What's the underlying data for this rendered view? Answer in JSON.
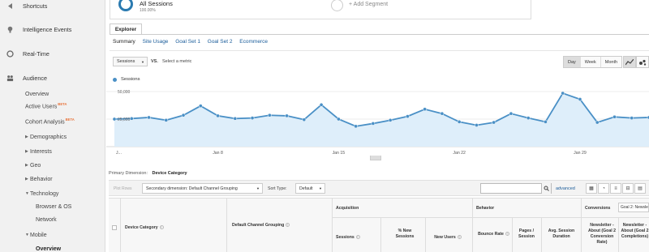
{
  "sidebar": {
    "items": [
      {
        "label": "Shortcuts",
        "icon": "arrow-left-icon"
      },
      {
        "label": "Intelligence Events",
        "icon": "bulb-icon"
      },
      {
        "label": "Real-Time",
        "icon": "clock-icon"
      },
      {
        "label": "Audience",
        "icon": "people-icon"
      }
    ],
    "sub": {
      "overview": "Overview",
      "active_users": "Active Users",
      "cohort_analysis": "Cohort Analysis",
      "beta": "BETA",
      "demographics": "Demographics",
      "interests": "Interests",
      "geo": "Geo",
      "behavior": "Behavior",
      "technology": "Technology",
      "browser_os": "Browser & OS",
      "network": "Network",
      "mobile": "Mobile",
      "mobile_overview": "Overview"
    }
  },
  "segments": {
    "active_name": "All Sessions",
    "active_pct": "100.00%",
    "add_label": "+ Add Segment"
  },
  "explorer": {
    "tab": "Explorer",
    "subtabs": [
      "Summary",
      "Site Usage",
      "Goal Set 1",
      "Goal Set 2",
      "Ecommerce"
    ]
  },
  "chart_controls": {
    "metric": "Sessions",
    "vs": "VS.",
    "select_metric": "Select a metric",
    "periods": [
      "Day",
      "Week",
      "Month"
    ],
    "active_period": "Day"
  },
  "chart_data": {
    "type": "line",
    "series": [
      {
        "name": "Sessions",
        "values": [
          25000,
          25500,
          26500,
          24000,
          28500,
          37000,
          28000,
          25500,
          26000,
          28500,
          28000,
          24500,
          38000,
          25000,
          18500,
          21000,
          24000,
          27500,
          34000,
          30000,
          22500,
          19500,
          22000,
          30000,
          26000,
          22500,
          48500,
          43000,
          22000,
          27000,
          26000,
          26500
        ]
      }
    ],
    "x_tick_labels": [
      "J...",
      "Jan 8",
      "Jan 15",
      "Jan 22",
      "Jan 29"
    ],
    "y_tick_labels": [
      "50,000",
      "25,000"
    ],
    "ylim": [
      0,
      50000
    ],
    "grid": true,
    "color": "#4a90c6",
    "fill": "#deeefa"
  },
  "table": {
    "primary_dimension_label": "Primary Dimension:",
    "primary_dimension": "Device Category",
    "plot_rows": "Plot Rows",
    "secondary_dimension": "Secondary dimension: Default Channel Grouping",
    "sort_type_label": "Sort Type:",
    "sort_type": "Default",
    "advanced": "advanced",
    "headers": {
      "device_category": "Device Category",
      "channel_grouping": "Default Channel Grouping",
      "acquisition": "Acquisition",
      "behavior": "Behavior",
      "conversions": "Conversions",
      "goal_select": "Goal 2: Newsle",
      "sessions": "Sessions",
      "new_sessions": "% New Sessions",
      "new_users": "New Users",
      "bounce_rate": "Bounce Rate",
      "pages_session": "Pages / Session",
      "avg_duration": "Avg. Session Duration",
      "newsletter_rate": "Newsletter - About (Goal 2 Conversion Rate)",
      "newsletter_comp": "Newsletter - About (Goal 2 Completions)"
    }
  }
}
